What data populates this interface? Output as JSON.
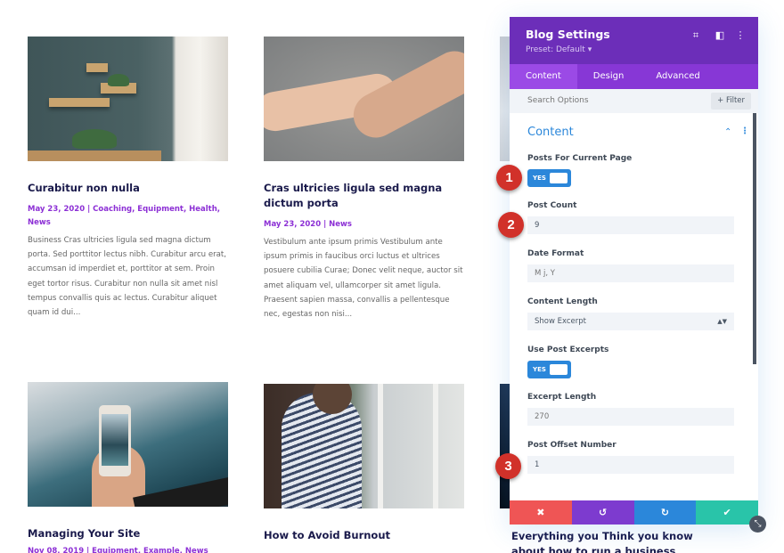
{
  "posts": [
    {
      "title": "Curabitur non nulla",
      "meta": "May 23, 2020 | Coaching, Equipment, Health, News",
      "excerpt": "Business Cras ultricies ligula sed magna dictum porta. Sed porttitor lectus nibh. Curabitur arcu erat, accumsan id imperdiet et, porttitor at sem. Proin eget tortor risus. Curabitur non nulla sit amet nisl tempus convallis quis ac lectus. Curabitur aliquet quam id dui..."
    },
    {
      "title": "Cras ultricies ligula sed magna dictum porta",
      "meta": "May 23, 2020 | News",
      "excerpt": "Vestibulum ante ipsum primis Vestibulum ante ipsum primis in faucibus orci luctus et ultrices posuere cubilia Curae; Donec velit neque, auctor sit amet aliquam vel, ullamcorper sit amet ligula. Praesent sapien massa, convallis a pellentesque nec, egestas non nisi..."
    },
    {
      "title": "Managing Your Site",
      "meta": "Nov 08, 2019 | Equipment, Example, News"
    },
    {
      "title": "How to Avoid Burnout"
    },
    {
      "title": "Everything you Think you know about how to run a business"
    }
  ],
  "panel": {
    "title": "Blog Settings",
    "preset": "Preset: Default ▾",
    "header_icons": [
      "focus-icon",
      "split-view-icon",
      "more-options-icon"
    ],
    "tabs": [
      "Content",
      "Design",
      "Advanced"
    ],
    "active_tab": "Content",
    "search_placeholder": "Search Options",
    "filter_label": "+ Filter",
    "section_title": "Content",
    "fields": {
      "posts_current_page": {
        "label": "Posts For Current Page",
        "value": "YES"
      },
      "post_count": {
        "label": "Post Count",
        "value": "9"
      },
      "date_format": {
        "label": "Date Format",
        "placeholder": "M j, Y"
      },
      "content_length": {
        "label": "Content Length",
        "value": "Show Excerpt"
      },
      "use_post_excerpts": {
        "label": "Use Post Excerpts",
        "value": "YES"
      },
      "excerpt_length": {
        "label": "Excerpt Length",
        "placeholder": "270"
      },
      "post_offset": {
        "label": "Post Offset Number",
        "value": "1"
      }
    },
    "footer": {
      "discard": "✖",
      "undo": "↺",
      "redo": "↻",
      "save": "✔"
    }
  },
  "badges": [
    "1",
    "2",
    "3"
  ],
  "colors": {
    "header_purple": "#6c2eb9",
    "tab_purple": "#8737d6",
    "accent_blue": "#2b87da",
    "meta_purple": "#8c2fd5",
    "discard_red": "#ef5555",
    "save_green": "#29c4a9",
    "badge_red": "#d1312a"
  }
}
